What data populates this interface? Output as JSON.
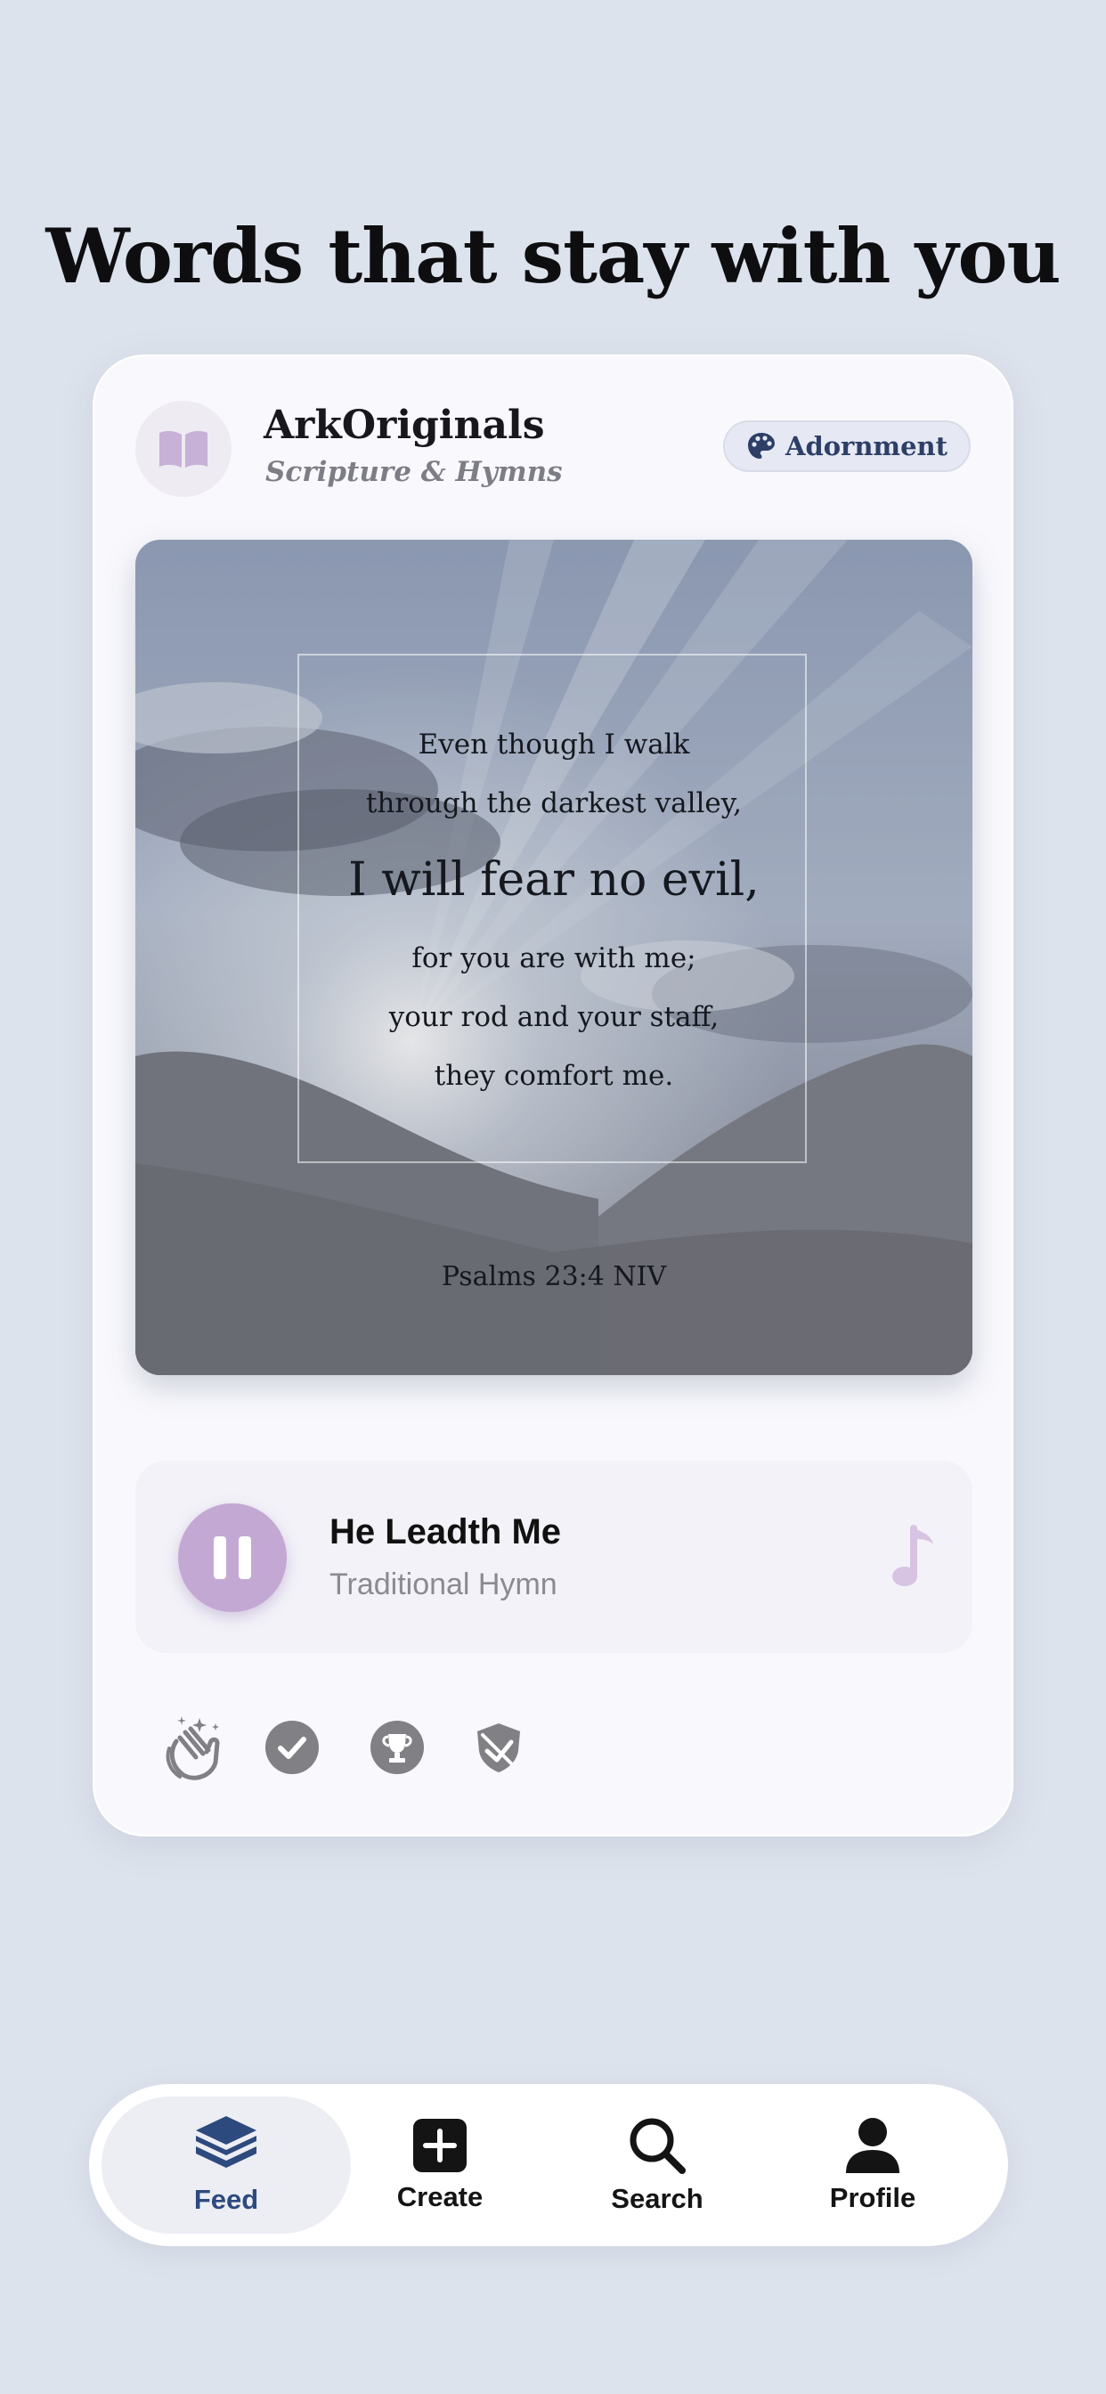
{
  "headline": "Words that stay with you",
  "card": {
    "account_name": "ArkOriginals",
    "account_subtitle": "Scripture & Hymns",
    "adornment_button": "Adornment",
    "verse": {
      "lines": [
        "Even though I walk",
        "through the darkest valley,",
        "I will fear no evil,",
        "for you are with me;",
        "your rod and your staff,",
        "they comfort me."
      ],
      "reference": "Psalms 23:4  NIV"
    },
    "player": {
      "title": "He Leadth Me",
      "subtitle": "Traditional Hymn",
      "state": "playing",
      "icon": "music-note-icon"
    },
    "badges": [
      "clapping-hands-icon",
      "checkmark-circle-icon",
      "trophy-icon",
      "shield-check-icon"
    ]
  },
  "tabbar": {
    "active": "Feed",
    "tabs": [
      {
        "label": "Feed",
        "icon": "stack-icon"
      },
      {
        "label": "Create",
        "icon": "plus-square-icon"
      },
      {
        "label": "Search",
        "icon": "search-icon"
      },
      {
        "label": "Profile",
        "icon": "person-icon"
      }
    ]
  },
  "colors": {
    "background": "#dde3ec",
    "accent_purple": "#c3a8d4",
    "accent_navy": "#2d4a7e",
    "badge_grey": "#808085"
  }
}
